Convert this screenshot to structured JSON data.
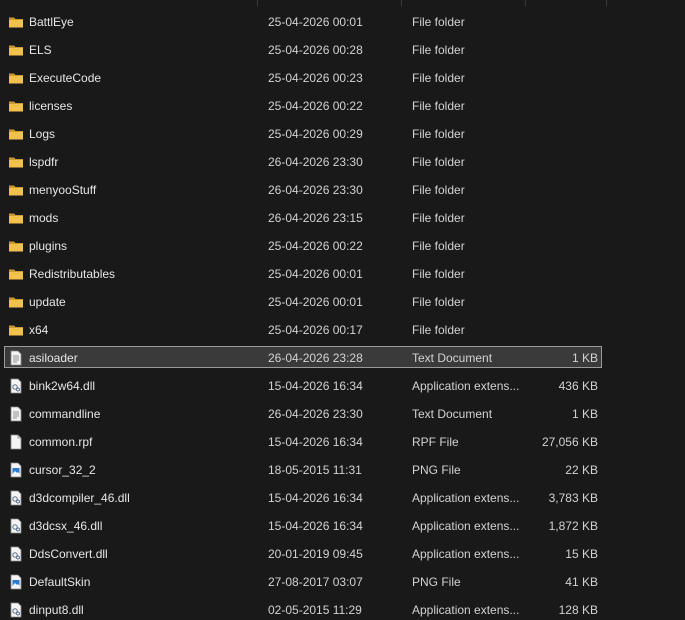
{
  "colors": {
    "background": "#191919",
    "selected_row": "#3a3a3a",
    "folder_icon": "#f2c14e",
    "text": "#e6e6e6"
  },
  "files": [
    {
      "name": "BattlEye",
      "date": "25-04-2026 00:01",
      "type": "File folder",
      "size": "",
      "icon": "folder-icon"
    },
    {
      "name": "ELS",
      "date": "25-04-2026 00:28",
      "type": "File folder",
      "size": "",
      "icon": "folder-icon"
    },
    {
      "name": "ExecuteCode",
      "date": "25-04-2026 00:23",
      "type": "File folder",
      "size": "",
      "icon": "folder-icon"
    },
    {
      "name": "licenses",
      "date": "25-04-2026 00:22",
      "type": "File folder",
      "size": "",
      "icon": "folder-icon"
    },
    {
      "name": "Logs",
      "date": "25-04-2026 00:29",
      "type": "File folder",
      "size": "",
      "icon": "folder-icon"
    },
    {
      "name": "lspdfr",
      "date": "26-04-2026 23:30",
      "type": "File folder",
      "size": "",
      "icon": "folder-icon"
    },
    {
      "name": "menyooStuff",
      "date": "26-04-2026 23:30",
      "type": "File folder",
      "size": "",
      "icon": "folder-icon"
    },
    {
      "name": "mods",
      "date": "26-04-2026 23:15",
      "type": "File folder",
      "size": "",
      "icon": "folder-icon"
    },
    {
      "name": "plugins",
      "date": "25-04-2026 00:22",
      "type": "File folder",
      "size": "",
      "icon": "folder-icon"
    },
    {
      "name": "Redistributables",
      "date": "25-04-2026 00:01",
      "type": "File folder",
      "size": "",
      "icon": "folder-icon"
    },
    {
      "name": "update",
      "date": "25-04-2026 00:01",
      "type": "File folder",
      "size": "",
      "icon": "folder-icon"
    },
    {
      "name": "x64",
      "date": "25-04-2026 00:17",
      "type": "File folder",
      "size": "",
      "icon": "folder-icon"
    },
    {
      "name": "asiloader",
      "date": "26-04-2026 23:28",
      "type": "Text Document",
      "size": "1 KB",
      "icon": "text-document-icon",
      "selected": true
    },
    {
      "name": "bink2w64.dll",
      "date": "15-04-2026 16:34",
      "type": "Application extens...",
      "size": "436 KB",
      "icon": "dll-file-icon"
    },
    {
      "name": "commandline",
      "date": "26-04-2026 23:30",
      "type": "Text Document",
      "size": "1 KB",
      "icon": "text-document-icon"
    },
    {
      "name": "common.rpf",
      "date": "15-04-2026 16:34",
      "type": "RPF File",
      "size": "27,056 KB",
      "icon": "blank-file-icon"
    },
    {
      "name": "cursor_32_2",
      "date": "18-05-2015 11:31",
      "type": "PNG File",
      "size": "22 KB",
      "icon": "image-file-icon"
    },
    {
      "name": "d3dcompiler_46.dll",
      "date": "15-04-2026 16:34",
      "type": "Application extens...",
      "size": "3,783 KB",
      "icon": "dll-file-icon"
    },
    {
      "name": "d3dcsx_46.dll",
      "date": "15-04-2026 16:34",
      "type": "Application extens...",
      "size": "1,872 KB",
      "icon": "dll-file-icon"
    },
    {
      "name": "DdsConvert.dll",
      "date": "20-01-2019 09:45",
      "type": "Application extens...",
      "size": "15 KB",
      "icon": "dll-file-icon"
    },
    {
      "name": "DefaultSkin",
      "date": "27-08-2017 03:07",
      "type": "PNG File",
      "size": "41 KB",
      "icon": "image-file-icon"
    },
    {
      "name": "dinput8.dll",
      "date": "02-05-2015 11:29",
      "type": "Application extens...",
      "size": "128 KB",
      "icon": "dll-file-icon"
    }
  ]
}
